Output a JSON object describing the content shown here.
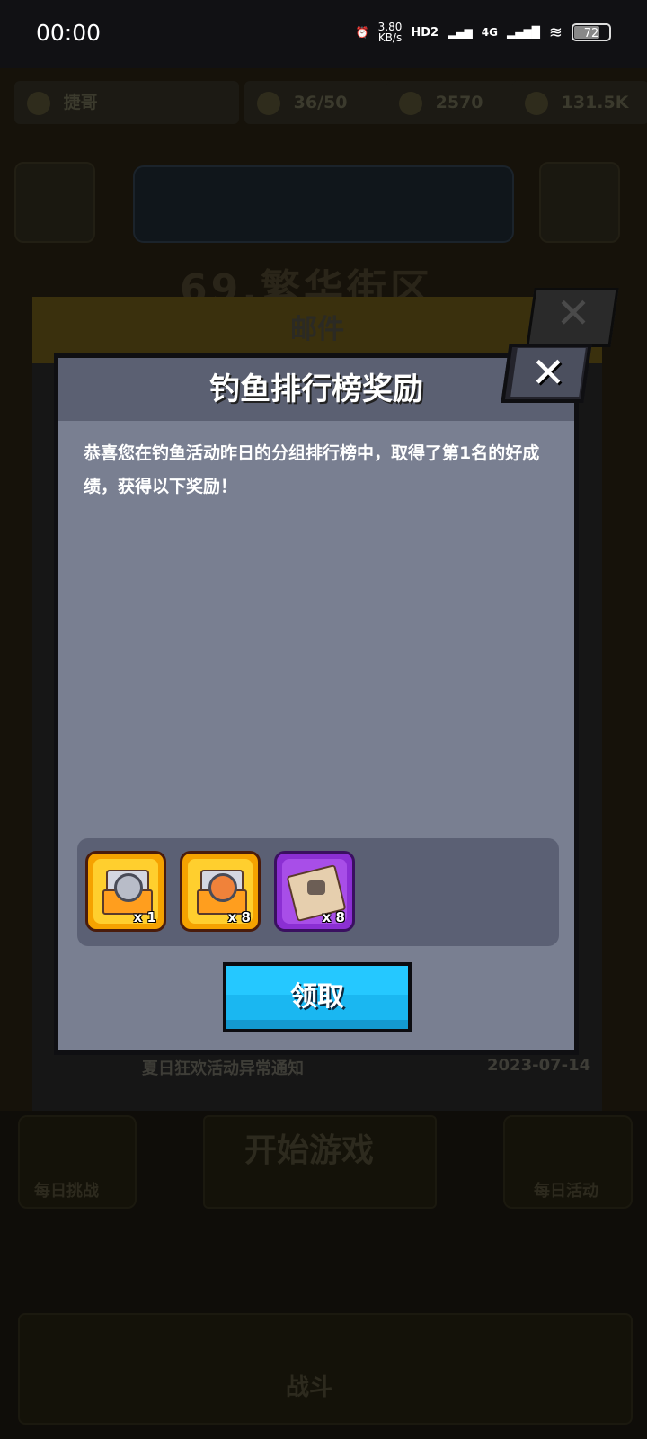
{
  "status_bar": {
    "time": "00:00",
    "net_speed": "3.80",
    "net_speed_unit": "KB/s",
    "hd_badge": "HD2",
    "network_type": "4G",
    "battery": "72"
  },
  "background": {
    "player_name": "捷哥",
    "energy": "36/50",
    "gems": "2570",
    "coins": "131.5K",
    "zone_title": "69.繁华街区",
    "mail_panel_title": "邮件",
    "mail_row_text": "夏日狂欢活动异常通知",
    "mail_row_date": "2023-07-14",
    "start_game": "开始游戏",
    "daily_challenge": "每日挑战",
    "daily_event": "每日活动",
    "battle_tab": "战斗"
  },
  "dialog": {
    "title": "钓鱼排行榜奖励",
    "message": "恭喜您在钓鱼活动昨日的分组排行榜中，取得了第1名的好成绩，获得以下奖励！",
    "rewards": [
      {
        "icon": "gold-chest-icon",
        "quantity": "x 1"
      },
      {
        "icon": "gold-chest-icon",
        "quantity": "x 8"
      },
      {
        "icon": "map-scroll-icon",
        "quantity": "x 8"
      }
    ],
    "claim_label": "领取",
    "close_glyph": "✕"
  }
}
